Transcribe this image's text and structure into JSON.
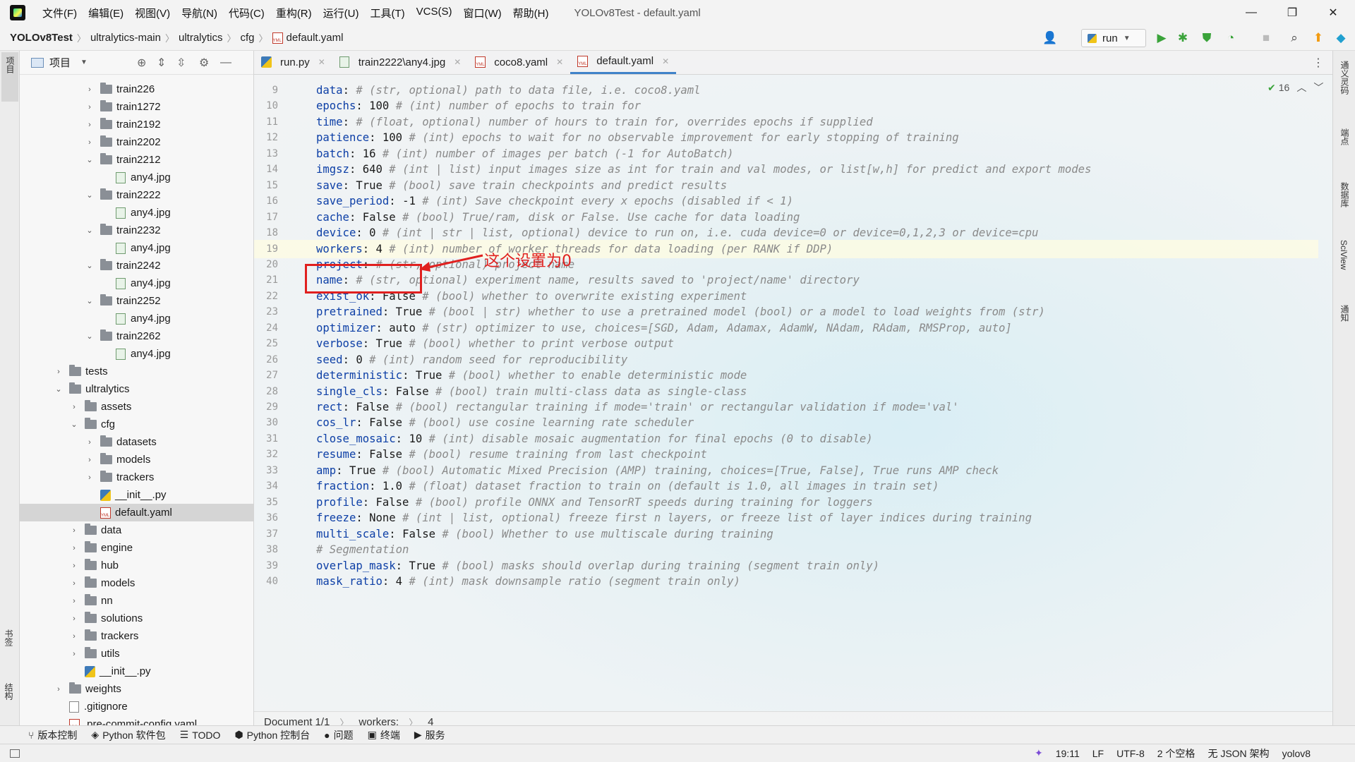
{
  "window": {
    "title": "YOLOv8Test - default.yaml",
    "menu": [
      "文件(F)",
      "编辑(E)",
      "视图(V)",
      "导航(N)",
      "代码(C)",
      "重构(R)",
      "运行(U)",
      "工具(T)",
      "VCS(S)",
      "窗口(W)",
      "帮助(H)"
    ],
    "controls": {
      "minimize": "—",
      "restore": "❐",
      "close": "✕"
    }
  },
  "breadcrumb": [
    "YOLOv8Test",
    "ultralytics-main",
    "ultralytics",
    "cfg",
    "default.yaml"
  ],
  "run_config": {
    "label": "run"
  },
  "left_strip": {
    "top_label": "项目",
    "bottom_labels": [
      "书签",
      "结构"
    ]
  },
  "right_strip": {
    "labels": [
      "通义灵码",
      "端点",
      "数据库",
      "SciView",
      "通知"
    ]
  },
  "project_panel": {
    "title": "项目",
    "tree": [
      {
        "label": "train226",
        "type": "folder",
        "depth": 2,
        "expanded": false
      },
      {
        "label": "train1272",
        "type": "folder",
        "depth": 2,
        "expanded": false
      },
      {
        "label": "train2192",
        "type": "folder",
        "depth": 2,
        "expanded": false
      },
      {
        "label": "train2202",
        "type": "folder",
        "depth": 2,
        "expanded": false
      },
      {
        "label": "train2212",
        "type": "folder",
        "depth": 2,
        "expanded": true
      },
      {
        "label": "any4.jpg",
        "type": "image",
        "depth": 3
      },
      {
        "label": "train2222",
        "type": "folder",
        "depth": 2,
        "expanded": true
      },
      {
        "label": "any4.jpg",
        "type": "image",
        "depth": 3
      },
      {
        "label": "train2232",
        "type": "folder",
        "depth": 2,
        "expanded": true
      },
      {
        "label": "any4.jpg",
        "type": "image",
        "depth": 3
      },
      {
        "label": "train2242",
        "type": "folder",
        "depth": 2,
        "expanded": true
      },
      {
        "label": "any4.jpg",
        "type": "image",
        "depth": 3
      },
      {
        "label": "train2252",
        "type": "folder",
        "depth": 2,
        "expanded": true
      },
      {
        "label": "any4.jpg",
        "type": "image",
        "depth": 3
      },
      {
        "label": "train2262",
        "type": "folder",
        "depth": 2,
        "expanded": true
      },
      {
        "label": "any4.jpg",
        "type": "image",
        "depth": 3
      },
      {
        "label": "tests",
        "type": "folder",
        "depth": 0,
        "expanded": false
      },
      {
        "label": "ultralytics",
        "type": "folder",
        "depth": 0,
        "expanded": true
      },
      {
        "label": "assets",
        "type": "folder",
        "depth": 1,
        "expanded": false
      },
      {
        "label": "cfg",
        "type": "folder",
        "depth": 1,
        "expanded": true
      },
      {
        "label": "datasets",
        "type": "folder",
        "depth": 2,
        "expanded": false
      },
      {
        "label": "models",
        "type": "folder",
        "depth": 2,
        "expanded": false
      },
      {
        "label": "trackers",
        "type": "folder",
        "depth": 2,
        "expanded": false
      },
      {
        "label": "__init__.py",
        "type": "python",
        "depth": 2
      },
      {
        "label": "default.yaml",
        "type": "yaml",
        "depth": 2,
        "selected": true
      },
      {
        "label": "data",
        "type": "folder",
        "depth": 1,
        "expanded": false
      },
      {
        "label": "engine",
        "type": "folder",
        "depth": 1,
        "expanded": false
      },
      {
        "label": "hub",
        "type": "folder",
        "depth": 1,
        "expanded": false
      },
      {
        "label": "models",
        "type": "folder",
        "depth": 1,
        "expanded": false
      },
      {
        "label": "nn",
        "type": "folder",
        "depth": 1,
        "expanded": false
      },
      {
        "label": "solutions",
        "type": "folder",
        "depth": 1,
        "expanded": false
      },
      {
        "label": "trackers",
        "type": "folder",
        "depth": 1,
        "expanded": false
      },
      {
        "label": "utils",
        "type": "folder",
        "depth": 1,
        "expanded": false
      },
      {
        "label": "__init__.py",
        "type": "python",
        "depth": 1
      },
      {
        "label": "weights",
        "type": "folder",
        "depth": 0,
        "expanded": false
      },
      {
        "label": ".gitignore",
        "type": "git",
        "depth": 0
      },
      {
        "label": ".pre-commit-config.yaml",
        "type": "yaml",
        "depth": 0
      }
    ]
  },
  "tabs": [
    {
      "label": "run.py",
      "active": false
    },
    {
      "label": "train2222\\any4.jpg",
      "active": false
    },
    {
      "label": "coco8.yaml",
      "active": false
    },
    {
      "label": "default.yaml",
      "active": true
    }
  ],
  "inspection": {
    "count": "16"
  },
  "editor_lines": [
    {
      "n": "9",
      "key": "data",
      "value": "",
      "comment": "# (str, optional) path to data file, i.e. coco8.yaml"
    },
    {
      "n": "10",
      "key": "epochs",
      "value": "100",
      "comment": "# (int) number of epochs to train for"
    },
    {
      "n": "11",
      "key": "time",
      "value": "",
      "comment": "# (float, optional) number of hours to train for, overrides epochs if supplied"
    },
    {
      "n": "12",
      "key": "patience",
      "value": "100",
      "comment": "# (int) epochs to wait for no observable improvement for early stopping of training"
    },
    {
      "n": "13",
      "key": "batch",
      "value": "16",
      "comment": "# (int) number of images per batch (-1 for AutoBatch)"
    },
    {
      "n": "14",
      "key": "imgsz",
      "value": "640",
      "comment": "# (int | list) input images size as int for train and val modes, or list[w,h] for predict and export modes"
    },
    {
      "n": "15",
      "key": "save",
      "value": "True",
      "comment": "# (bool) save train checkpoints and predict results"
    },
    {
      "n": "16",
      "key": "save_period",
      "value": "-1",
      "comment": "# (int) Save checkpoint every x epochs (disabled if < 1)"
    },
    {
      "n": "17",
      "key": "cache",
      "value": "False",
      "comment": "# (bool) True/ram, disk or False. Use cache for data loading"
    },
    {
      "n": "18",
      "key": "device",
      "value": "0",
      "comment": "# (int | str | list, optional) device to run on, i.e. cuda device=0 or device=0,1,2,3 or device=cpu"
    },
    {
      "n": "19",
      "key": "workers",
      "value": "4",
      "comment": "# (int) number of worker threads for data loading (per RANK if DDP)"
    },
    {
      "n": "20",
      "key": "project",
      "value": "",
      "comment": "# (str, optional) project name"
    },
    {
      "n": "21",
      "key": "name",
      "value": "",
      "comment": "# (str, optional) experiment name, results saved to 'project/name' directory"
    },
    {
      "n": "22",
      "key": "exist_ok",
      "value": "False",
      "comment": "# (bool) whether to overwrite existing experiment"
    },
    {
      "n": "23",
      "key": "pretrained",
      "value": "True",
      "comment": "# (bool | str) whether to use a pretrained model (bool) or a model to load weights from (str)"
    },
    {
      "n": "24",
      "key": "optimizer",
      "value": "auto",
      "comment": "# (str) optimizer to use, choices=[SGD, Adam, Adamax, AdamW, NAdam, RAdam, RMSProp, auto]"
    },
    {
      "n": "25",
      "key": "verbose",
      "value": "True",
      "comment": "# (bool) whether to print verbose output"
    },
    {
      "n": "26",
      "key": "seed",
      "value": "0",
      "comment": "# (int) random seed for reproducibility"
    },
    {
      "n": "27",
      "key": "deterministic",
      "value": "True",
      "comment": "# (bool) whether to enable deterministic mode"
    },
    {
      "n": "28",
      "key": "single_cls",
      "value": "False",
      "comment": "# (bool) train multi-class data as single-class"
    },
    {
      "n": "29",
      "key": "rect",
      "value": "False",
      "comment": "# (bool) rectangular training if mode='train' or rectangular validation if mode='val'"
    },
    {
      "n": "30",
      "key": "cos_lr",
      "value": "False",
      "comment": "# (bool) use cosine learning rate scheduler"
    },
    {
      "n": "31",
      "key": "close_mosaic",
      "value": "10",
      "comment": "# (int) disable mosaic augmentation for final epochs (0 to disable)"
    },
    {
      "n": "32",
      "key": "resume",
      "value": "False",
      "comment": "# (bool) resume training from last checkpoint"
    },
    {
      "n": "33",
      "key": "amp",
      "value": "True",
      "comment": "# (bool) Automatic Mixed Precision (AMP) training, choices=[True, False], True runs AMP check"
    },
    {
      "n": "34",
      "key": "fraction",
      "value": "1.0",
      "comment": "# (float) dataset fraction to train on (default is 1.0, all images in train set)"
    },
    {
      "n": "35",
      "key": "profile",
      "value": "False",
      "comment": "# (bool) profile ONNX and TensorRT speeds during training for loggers"
    },
    {
      "n": "36",
      "key": "freeze",
      "value": "None",
      "comment": "# (int | list, optional) freeze first n layers, or freeze list of layer indices during training"
    },
    {
      "n": "37",
      "key": "multi_scale",
      "value": "False",
      "comment": "# (bool) Whether to use multiscale during training"
    },
    {
      "n": "38",
      "key": "",
      "value": "",
      "comment": "# Segmentation"
    },
    {
      "n": "39",
      "key": "overlap_mask",
      "value": "True",
      "comment": "# (bool) masks should overlap during training (segment train only)"
    },
    {
      "n": "40",
      "key": "mask_ratio",
      "value": "4",
      "comment": "# (int) mask downsample ratio (segment train only)"
    }
  ],
  "annotation": {
    "text": "这个设置为0",
    "color": "#e0201f"
  },
  "editor_breadcrumb": {
    "document": "Document 1/1",
    "key": "workers:",
    "value": "4"
  },
  "tool_windows": [
    "版本控制",
    "Python 软件包",
    "TODO",
    "Python 控制台",
    "问题",
    "终端",
    "服务"
  ],
  "status_bar": {
    "position": "19:11",
    "line_sep": "LF",
    "encoding": "UTF-8",
    "indent": "2 个空格",
    "schema": "无 JSON 架构",
    "interpreter": "yolov8"
  },
  "colors": {
    "accent": "#4083c9",
    "key": "#0d3fa6",
    "comment": "#8a8a8a",
    "annotation": "#e0201f"
  }
}
